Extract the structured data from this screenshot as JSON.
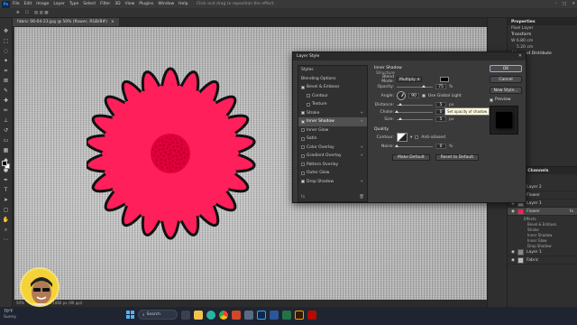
{
  "menubar": {
    "items": [
      "File",
      "Edit",
      "Image",
      "Layer",
      "Type",
      "Select",
      "Filter",
      "3D",
      "View",
      "Plugins",
      "Window",
      "Help"
    ],
    "hint": "Click and drag to reposition the effect."
  },
  "document_tab": {
    "title": "fabric 06-04-23.jpg @ 50% (flower, RGB/8#)",
    "close": "×"
  },
  "status_bar": {
    "zoom": "50%",
    "info": "1920 px x 1080 px (96 ppi)"
  },
  "right_panel": {
    "properties_title": "Properties",
    "pixel_layer": "Pixel Layer",
    "transform": "Transform",
    "w_label": "W",
    "w_value": "6.80 cm",
    "h_value": "5.20 cm",
    "x_value": "",
    "y_value": "",
    "align_title": "Align and Distribute"
  },
  "layers_panel": {
    "tabs": "Layers   Channels",
    "layers": [
      {
        "name": "Layer 2"
      },
      {
        "name": "Flower"
      },
      {
        "name": "Layer 1"
      },
      {
        "name": "Flower",
        "selected": true
      }
    ],
    "effects_label": "Effects",
    "effects": [
      "Bevel & Emboss",
      "Stroke",
      "Inner Shadow",
      "Inner Glow",
      "Drop Shadow"
    ],
    "bottom_layers": [
      {
        "name": "Layer 1"
      },
      {
        "name": "Fabric"
      }
    ]
  },
  "layer_style_dialog": {
    "title": "Layer Style",
    "styles_header": "Styles",
    "blending_options": "Blending Options",
    "styles": [
      {
        "label": "Bevel & Emboss",
        "checked": true
      },
      {
        "label": "Contour",
        "checked": false,
        "indent": true
      },
      {
        "label": "Texture",
        "checked": false,
        "indent": true
      },
      {
        "label": "Stroke",
        "checked": true,
        "plus": true
      },
      {
        "label": "Inner Shadow",
        "checked": true,
        "plus": true,
        "selected": true
      },
      {
        "label": "Inner Glow",
        "checked": false
      },
      {
        "label": "Satin",
        "checked": false
      },
      {
        "label": "Color Overlay",
        "checked": false,
        "plus": true
      },
      {
        "label": "Gradient Overlay",
        "checked": false,
        "plus": true
      },
      {
        "label": "Pattern Overlay",
        "checked": false
      },
      {
        "label": "Outer Glow",
        "checked": false
      },
      {
        "label": "Drop Shadow",
        "checked": true,
        "plus": true
      }
    ],
    "section_title": "Inner Shadow",
    "structure": "Structure",
    "blend_mode_label": "Blend Mode:",
    "blend_mode_value": "Multiply",
    "opacity_label": "Opacity:",
    "opacity_value": "75",
    "angle_label": "Angle:",
    "angle_value": "90",
    "use_global_light": "Use Global Light",
    "tooltip": "Set opacity of shadow",
    "distance_label": "Distance:",
    "distance_value": "5",
    "choke_label": "Choke:",
    "choke_value": "0",
    "size_label": "Size:",
    "size_value": "5",
    "quality": "Quality",
    "contour_label": "Contour:",
    "anti_aliased": "Anti-aliased",
    "noise_label": "Noise:",
    "noise_value": "0",
    "unit_pct": "%",
    "unit_px": "px",
    "make_default": "Make Default",
    "reset_default": "Reset to Default",
    "ok": "OK",
    "cancel": "Cancel",
    "new_style": "New Style...",
    "preview": "Preview"
  },
  "taskbar": {
    "temp": "70°F",
    "weather": "Sunny",
    "search": "Search",
    "time": "",
    "date": ""
  },
  "colors": {
    "flower": "#ff1f5a",
    "flower_center": "#e0003a",
    "outline": "#111111",
    "accent": "#31a8ff"
  }
}
